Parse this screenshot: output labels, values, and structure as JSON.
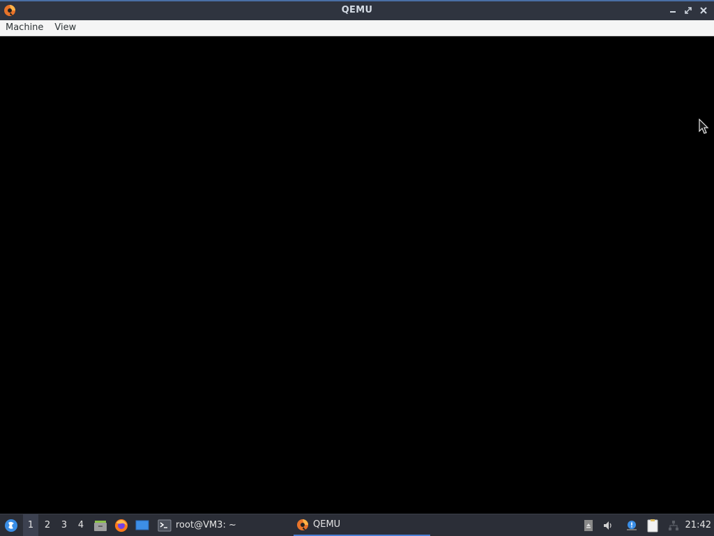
{
  "window": {
    "title": "QEMU",
    "controls": [
      "minimize-icon",
      "maximize-icon",
      "close-icon"
    ]
  },
  "menubar": {
    "items": [
      "Machine",
      "View"
    ]
  },
  "taskbar": {
    "workspaces": [
      "1",
      "2",
      "3",
      "4"
    ],
    "active_workspace": "1",
    "launchers": [
      "file-manager-icon",
      "firefox-icon",
      "desktop-icon"
    ],
    "tasks": [
      {
        "label": "root@VM3: ~",
        "icon": "terminal-icon"
      },
      {
        "label": "QEMU",
        "icon": "qemu-icon"
      }
    ],
    "tray": [
      "drive-icon",
      "volume-icon",
      "notification-icon",
      "clipboard-icon",
      "network-icon"
    ],
    "clock": "21:42"
  },
  "colors": {
    "titlebar": "#2f343f",
    "menubar": "#f5f5f5",
    "vm_screen": "#000000",
    "taskbar": "#2b2e37",
    "task_active_underline": "#4a7fd4"
  }
}
